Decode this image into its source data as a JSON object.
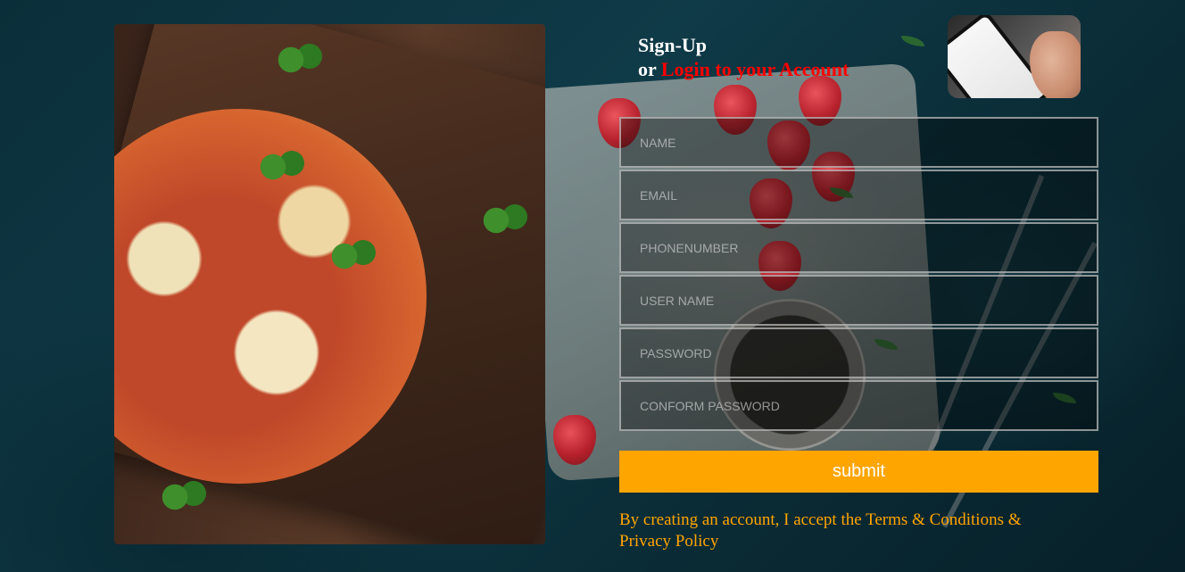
{
  "header": {
    "signup_label": "Sign-Up",
    "or_label": "or",
    "login_link_label": "Login to your Account"
  },
  "form": {
    "fields": [
      {
        "placeholder": "NAME"
      },
      {
        "placeholder": "EMAIL"
      },
      {
        "placeholder": "PHONENUMBER"
      },
      {
        "placeholder": "USER NAME"
      },
      {
        "placeholder": "PASSWORD"
      },
      {
        "placeholder": "CONFORM PASSWORD"
      }
    ],
    "submit_label": "submit"
  },
  "footer": {
    "terms_text": "By creating an account, I accept the Terms & Conditions & Privacy Policy"
  },
  "colors": {
    "accent": "#ffa500",
    "login_link": "#ff0000",
    "background": "#0b2f3a"
  },
  "images": {
    "hero": "pizza-photo",
    "thumbnail": "phone-food-delivery-photo"
  }
}
